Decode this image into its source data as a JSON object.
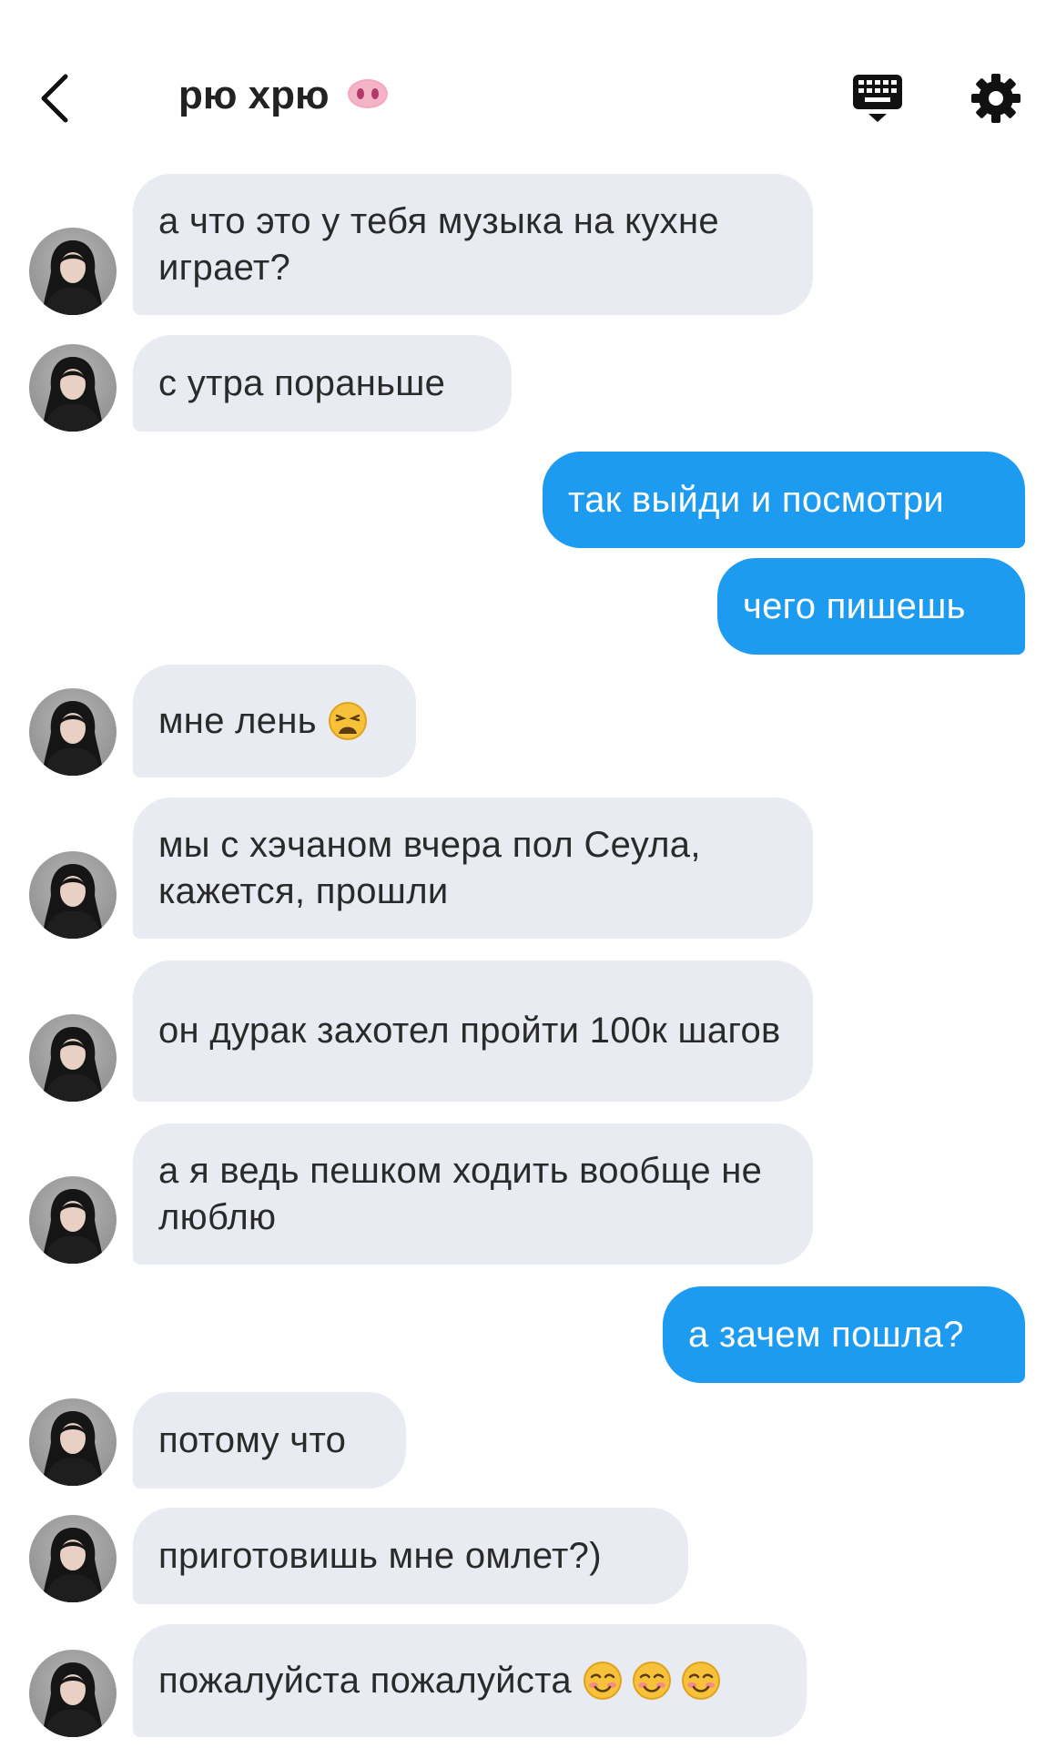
{
  "header": {
    "title": "рю хрю",
    "title_emoji": "pig-nose-icon",
    "icons": [
      "back-arrow-icon",
      "keyboard-icon",
      "gear-icon"
    ]
  },
  "messages": [
    {
      "from": "them",
      "text": "а что это у тебя музыка на кухне играет?"
    },
    {
      "from": "them",
      "text": "с утра пораньше"
    },
    {
      "from": "me",
      "text": "так выйди и посмотри"
    },
    {
      "from": "me",
      "text": "чего пишешь"
    },
    {
      "from": "them",
      "text": "мне лень",
      "emoji": "weary-face-icon"
    },
    {
      "from": "them",
      "text": "мы с хэчаном вчера пол Сеула, кажется, прошли"
    },
    {
      "from": "them",
      "text": "он дурак захотел пройти 100к шагов"
    },
    {
      "from": "them",
      "text": "а я ведь пешком ходить вообще не люблю"
    },
    {
      "from": "me",
      "text": "а зачем пошла?"
    },
    {
      "from": "them",
      "text": "потому что"
    },
    {
      "from": "them",
      "text": "приготовишь мне омлет?)"
    },
    {
      "from": "them",
      "text": "пожалуйста пожалуйста",
      "emoji": "smiling-face-icon"
    }
  ],
  "colors": {
    "incoming_bubble": "#e9ebf2",
    "outgoing_bubble": "#1d9bf0",
    "incoming_text": "#2a2a2a",
    "outgoing_text": "#ffffff",
    "background": "#ffffff"
  }
}
